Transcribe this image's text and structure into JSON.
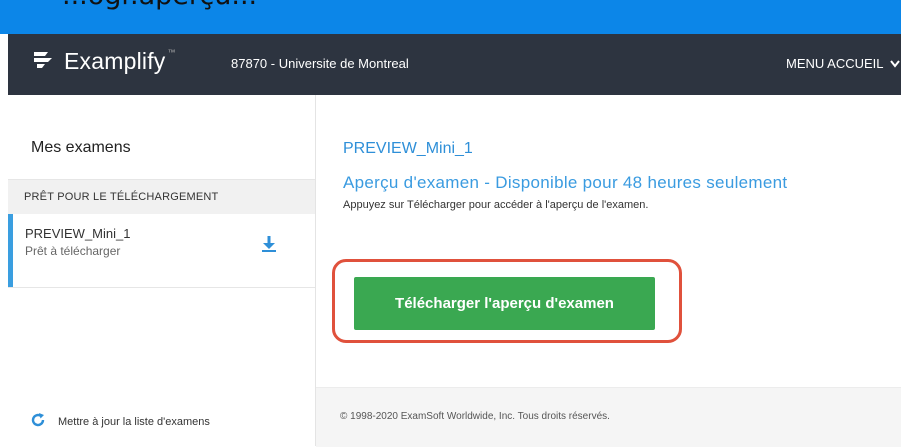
{
  "top_strip": {
    "clipped_text": "...ogr.aperçu..."
  },
  "header": {
    "brand": "Examplify",
    "trademark": "™",
    "institution": "87870 - Universite de Montreal",
    "menu_label": "MENU ACCUEIL"
  },
  "sidebar": {
    "title": "Mes examens",
    "section_header": "PRÊT POUR LE TÉLÉCHARGEMENT",
    "items": [
      {
        "name": "PREVIEW_Mini_1",
        "status": "Prêt à télécharger"
      }
    ],
    "refresh_label": "Mettre à jour la liste d'examens"
  },
  "main": {
    "exam_title": "PREVIEW_Mini_1",
    "subtitle": "Aperçu d'examen - Disponible pour 48 heures seulement",
    "description": "Appuyez sur Télécharger pour accéder à l'aperçu de l'examen.",
    "download_button": "Télécharger l'aperçu d'examen",
    "footer": "© 1998-2020 ExamSoft Worldwide, Inc. Tous droits réservés."
  },
  "colors": {
    "header_bg": "#2d3440",
    "accent_blue": "#3a9be0",
    "button_green": "#3aa851",
    "highlight_red": "#e0513c"
  },
  "icons": [
    "examplify-logo-icon",
    "chevron-down-icon",
    "download-icon",
    "refresh-icon"
  ]
}
